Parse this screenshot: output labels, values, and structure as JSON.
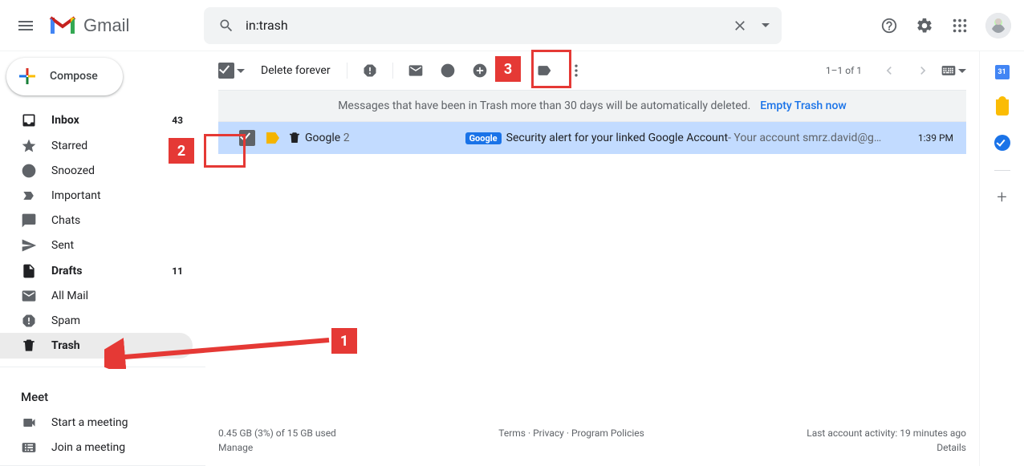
{
  "header": {
    "logo_text": "Gmail",
    "search_value": "in:trash"
  },
  "compose_label": "Compose",
  "sidebar_items": [
    {
      "label": "Inbox",
      "count": "43"
    },
    {
      "label": "Starred",
      "count": ""
    },
    {
      "label": "Snoozed",
      "count": ""
    },
    {
      "label": "Important",
      "count": ""
    },
    {
      "label": "Chats",
      "count": ""
    },
    {
      "label": "Sent",
      "count": ""
    },
    {
      "label": "Drafts",
      "count": "11"
    },
    {
      "label": "All Mail",
      "count": ""
    },
    {
      "label": "Spam",
      "count": ""
    },
    {
      "label": "Trash",
      "count": ""
    }
  ],
  "meet": {
    "header": "Meet",
    "start": "Start a meeting",
    "join": "Join a meeting"
  },
  "toolbar": {
    "delete_forever": "Delete forever",
    "page_count": "1–1 of 1"
  },
  "banner": {
    "text": "Messages that have been in Trash more than 30 days will be automatically deleted.",
    "action": "Empty Trash now"
  },
  "mail": {
    "sender": "Google",
    "thread_count": "2",
    "badge": "Google",
    "subject": "Security alert for your linked Google Account",
    "snippet": " - Your account smrz.david@g…",
    "time": "1:39 PM"
  },
  "footer": {
    "storage_line": "0.45 GB (3%) of 15 GB used",
    "manage": "Manage",
    "terms": "Terms",
    "privacy": "Privacy",
    "policies": "Program Policies",
    "activity": "Last account activity: 19 minutes ago",
    "details": "Details"
  },
  "annotations": {
    "n1": "1",
    "n2": "2",
    "n3": "3"
  }
}
